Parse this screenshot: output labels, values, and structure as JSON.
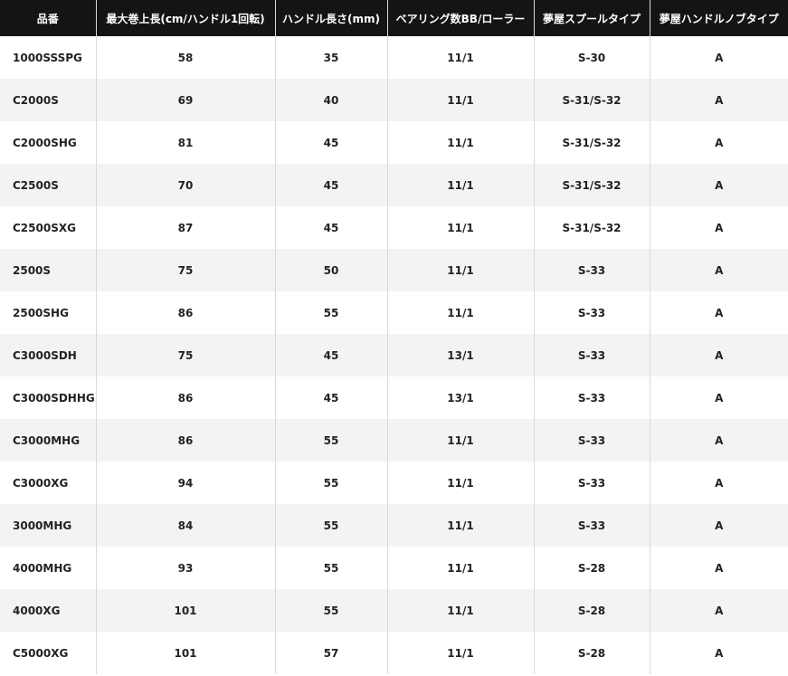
{
  "table": {
    "headers": [
      "品番",
      "最大巻上長(cm/ハンドル1回転)",
      "ハンドル長さ(mm)",
      "ベアリング数BB/ローラー",
      "夢屋スプールタイプ",
      "夢屋ハンドルノブタイプ"
    ],
    "rows": [
      [
        "1000SSSPG",
        "58",
        "35",
        "11/1",
        "S-30",
        "A"
      ],
      [
        "C2000S",
        "69",
        "40",
        "11/1",
        "S-31/S-32",
        "A"
      ],
      [
        "C2000SHG",
        "81",
        "45",
        "11/1",
        "S-31/S-32",
        "A"
      ],
      [
        "C2500S",
        "70",
        "45",
        "11/1",
        "S-31/S-32",
        "A"
      ],
      [
        "C2500SXG",
        "87",
        "45",
        "11/1",
        "S-31/S-32",
        "A"
      ],
      [
        "2500S",
        "75",
        "50",
        "11/1",
        "S-33",
        "A"
      ],
      [
        "2500SHG",
        "86",
        "55",
        "11/1",
        "S-33",
        "A"
      ],
      [
        "C3000SDH",
        "75",
        "45",
        "13/1",
        "S-33",
        "A"
      ],
      [
        "C3000SDHHG",
        "86",
        "45",
        "13/1",
        "S-33",
        "A"
      ],
      [
        "C3000MHG",
        "86",
        "55",
        "11/1",
        "S-33",
        "A"
      ],
      [
        "C3000XG",
        "94",
        "55",
        "11/1",
        "S-33",
        "A"
      ],
      [
        "3000MHG",
        "84",
        "55",
        "11/1",
        "S-33",
        "A"
      ],
      [
        "4000MHG",
        "93",
        "55",
        "11/1",
        "S-28",
        "A"
      ],
      [
        "4000XG",
        "101",
        "55",
        "11/1",
        "S-28",
        "A"
      ],
      [
        "C5000XG",
        "101",
        "57",
        "11/1",
        "S-28",
        "A"
      ]
    ]
  }
}
